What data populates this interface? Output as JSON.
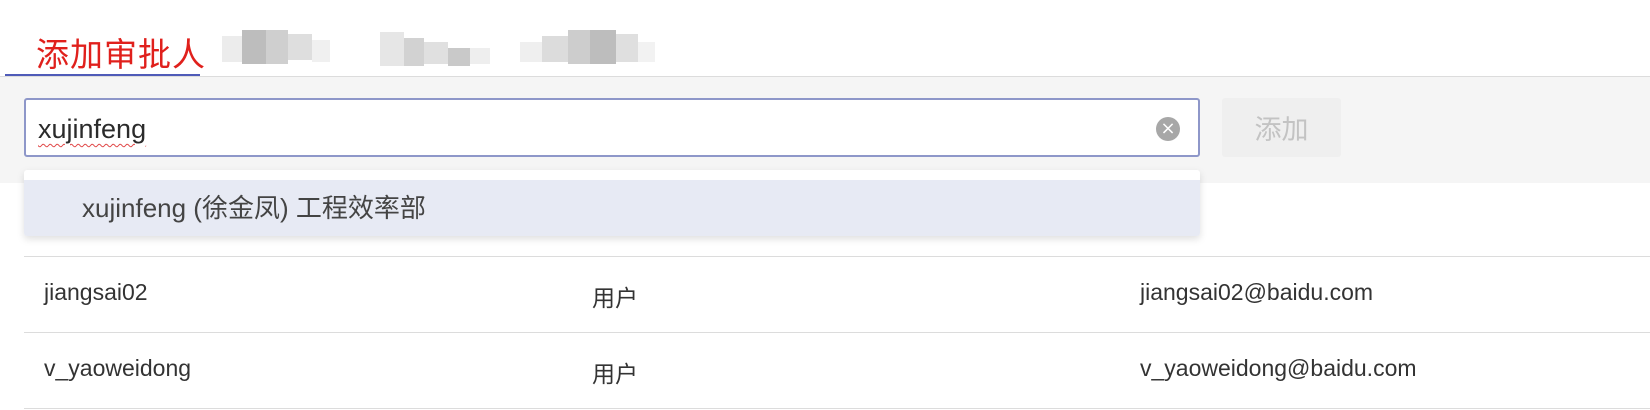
{
  "tab": {
    "title": "添加审批人"
  },
  "search": {
    "value": "xujinfeng",
    "clear_icon": "×"
  },
  "toolbar": {
    "add_label": "添加"
  },
  "suggestion": {
    "label": "xujinfeng (徐金凤) 工程效率部"
  },
  "table": {
    "rows": [
      {
        "name": "jiangsai02",
        "type": "用户",
        "email": "jiangsai02@baidu.com"
      },
      {
        "name": "v_yaoweidong",
        "type": "用户",
        "email": "v_yaoweidong@baidu.com"
      }
    ]
  },
  "colors": {
    "accent": "#4f5bb8",
    "title_red": "#e0201c",
    "focus_border": "#8e97c9"
  }
}
